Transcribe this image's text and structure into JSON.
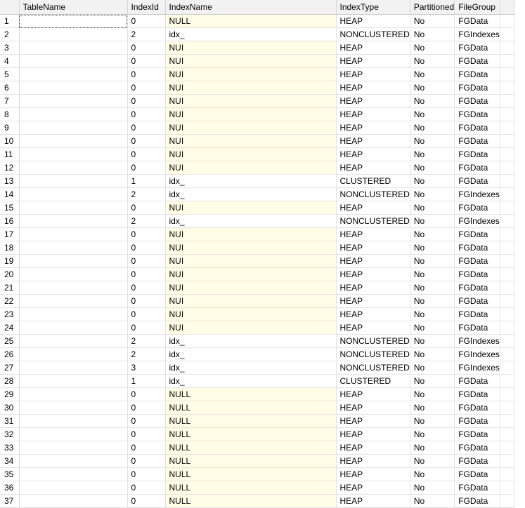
{
  "grid": {
    "columns": [
      "",
      "TableName",
      "IndexId",
      "IndexName",
      "IndexType",
      "Partitioned",
      "FileGroup"
    ],
    "rows": [
      {
        "n": "1",
        "id": "0",
        "name": "NULL",
        "type": "HEAP",
        "part": "No",
        "fg": "FGData",
        "null": true
      },
      {
        "n": "2",
        "id": "2",
        "name": "idx_",
        "type": "NONCLUSTERED",
        "part": "No",
        "fg": "FGIndexes",
        "null": false
      },
      {
        "n": "3",
        "id": "0",
        "name": "NUI",
        "type": "HEAP",
        "part": "No",
        "fg": "FGData",
        "null": true
      },
      {
        "n": "4",
        "id": "0",
        "name": "NUI",
        "type": "HEAP",
        "part": "No",
        "fg": "FGData",
        "null": true
      },
      {
        "n": "5",
        "id": "0",
        "name": "NUI",
        "type": "HEAP",
        "part": "No",
        "fg": "FGData",
        "null": true
      },
      {
        "n": "6",
        "id": "0",
        "name": "NUI",
        "type": "HEAP",
        "part": "No",
        "fg": "FGData",
        "null": true
      },
      {
        "n": "7",
        "id": "0",
        "name": "NUI",
        "type": "HEAP",
        "part": "No",
        "fg": "FGData",
        "null": true
      },
      {
        "n": "8",
        "id": "0",
        "name": "NUI",
        "type": "HEAP",
        "part": "No",
        "fg": "FGData",
        "null": true
      },
      {
        "n": "9",
        "id": "0",
        "name": "NUI",
        "type": "HEAP",
        "part": "No",
        "fg": "FGData",
        "null": true
      },
      {
        "n": "10",
        "id": "0",
        "name": "NUI",
        "type": "HEAP",
        "part": "No",
        "fg": "FGData",
        "null": true
      },
      {
        "n": "11",
        "id": "0",
        "name": "NUI",
        "type": "HEAP",
        "part": "No",
        "fg": "FGData",
        "null": true
      },
      {
        "n": "12",
        "id": "0",
        "name": "NUI",
        "type": "HEAP",
        "part": "No",
        "fg": "FGData",
        "null": true
      },
      {
        "n": "13",
        "id": "1",
        "name": "idx_",
        "type": "CLUSTERED",
        "part": "No",
        "fg": "FGData",
        "null": false
      },
      {
        "n": "14",
        "id": "2",
        "name": "idx_",
        "type": "NONCLUSTERED",
        "part": "No",
        "fg": "FGIndexes",
        "null": false
      },
      {
        "n": "15",
        "id": "0",
        "name": "NUI",
        "type": "HEAP",
        "part": "No",
        "fg": "FGData",
        "null": true
      },
      {
        "n": "16",
        "id": "2",
        "name": "idx_",
        "type": "NONCLUSTERED",
        "part": "No",
        "fg": "FGIndexes",
        "null": false
      },
      {
        "n": "17",
        "id": "0",
        "name": "NUI",
        "type": "HEAP",
        "part": "No",
        "fg": "FGData",
        "null": true
      },
      {
        "n": "18",
        "id": "0",
        "name": "NUI",
        "type": "HEAP",
        "part": "No",
        "fg": "FGData",
        "null": true
      },
      {
        "n": "19",
        "id": "0",
        "name": "NUI",
        "type": "HEAP",
        "part": "No",
        "fg": "FGData",
        "null": true
      },
      {
        "n": "20",
        "id": "0",
        "name": "NUI",
        "type": "HEAP",
        "part": "No",
        "fg": "FGData",
        "null": true
      },
      {
        "n": "21",
        "id": "0",
        "name": "NUI",
        "type": "HEAP",
        "part": "No",
        "fg": "FGData",
        "null": true
      },
      {
        "n": "22",
        "id": "0",
        "name": "NUI",
        "type": "HEAP",
        "part": "No",
        "fg": "FGData",
        "null": true
      },
      {
        "n": "23",
        "id": "0",
        "name": "NUI",
        "type": "HEAP",
        "part": "No",
        "fg": "FGData",
        "null": true
      },
      {
        "n": "24",
        "id": "0",
        "name": "NUI",
        "type": "HEAP",
        "part": "No",
        "fg": "FGData",
        "null": true
      },
      {
        "n": "25",
        "id": "2",
        "name": "idx_",
        "type": "NONCLUSTERED",
        "part": "No",
        "fg": "FGIndexes",
        "null": false
      },
      {
        "n": "26",
        "id": "2",
        "name": "idx_",
        "type": "NONCLUSTERED",
        "part": "No",
        "fg": "FGIndexes",
        "null": false
      },
      {
        "n": "27",
        "id": "3",
        "name": "idx_",
        "type": "NONCLUSTERED",
        "part": "No",
        "fg": "FGIndexes",
        "null": false
      },
      {
        "n": "28",
        "id": "1",
        "name": "idx_",
        "type": "CLUSTERED",
        "part": "No",
        "fg": "FGData",
        "null": false
      },
      {
        "n": "29",
        "id": "0",
        "name": "NULL",
        "type": "HEAP",
        "part": "No",
        "fg": "FGData",
        "null": true
      },
      {
        "n": "30",
        "id": "0",
        "name": "NULL",
        "type": "HEAP",
        "part": "No",
        "fg": "FGData",
        "null": true
      },
      {
        "n": "31",
        "id": "0",
        "name": "NULL",
        "type": "HEAP",
        "part": "No",
        "fg": "FGData",
        "null": true
      },
      {
        "n": "32",
        "id": "0",
        "name": "NULL",
        "type": "HEAP",
        "part": "No",
        "fg": "FGData",
        "null": true
      },
      {
        "n": "33",
        "id": "0",
        "name": "NULL",
        "type": "HEAP",
        "part": "No",
        "fg": "FGData",
        "null": true
      },
      {
        "n": "34",
        "id": "0",
        "name": "NULL",
        "type": "HEAP",
        "part": "No",
        "fg": "FGData",
        "null": true
      },
      {
        "n": "35",
        "id": "0",
        "name": "NULL",
        "type": "HEAP",
        "part": "No",
        "fg": "FGData",
        "null": true
      },
      {
        "n": "36",
        "id": "0",
        "name": "NULL",
        "type": "HEAP",
        "part": "No",
        "fg": "FGData",
        "null": true
      },
      {
        "n": "37",
        "id": "0",
        "name": "NULL",
        "type": "HEAP",
        "part": "No",
        "fg": "FGData",
        "null": true
      }
    ]
  }
}
